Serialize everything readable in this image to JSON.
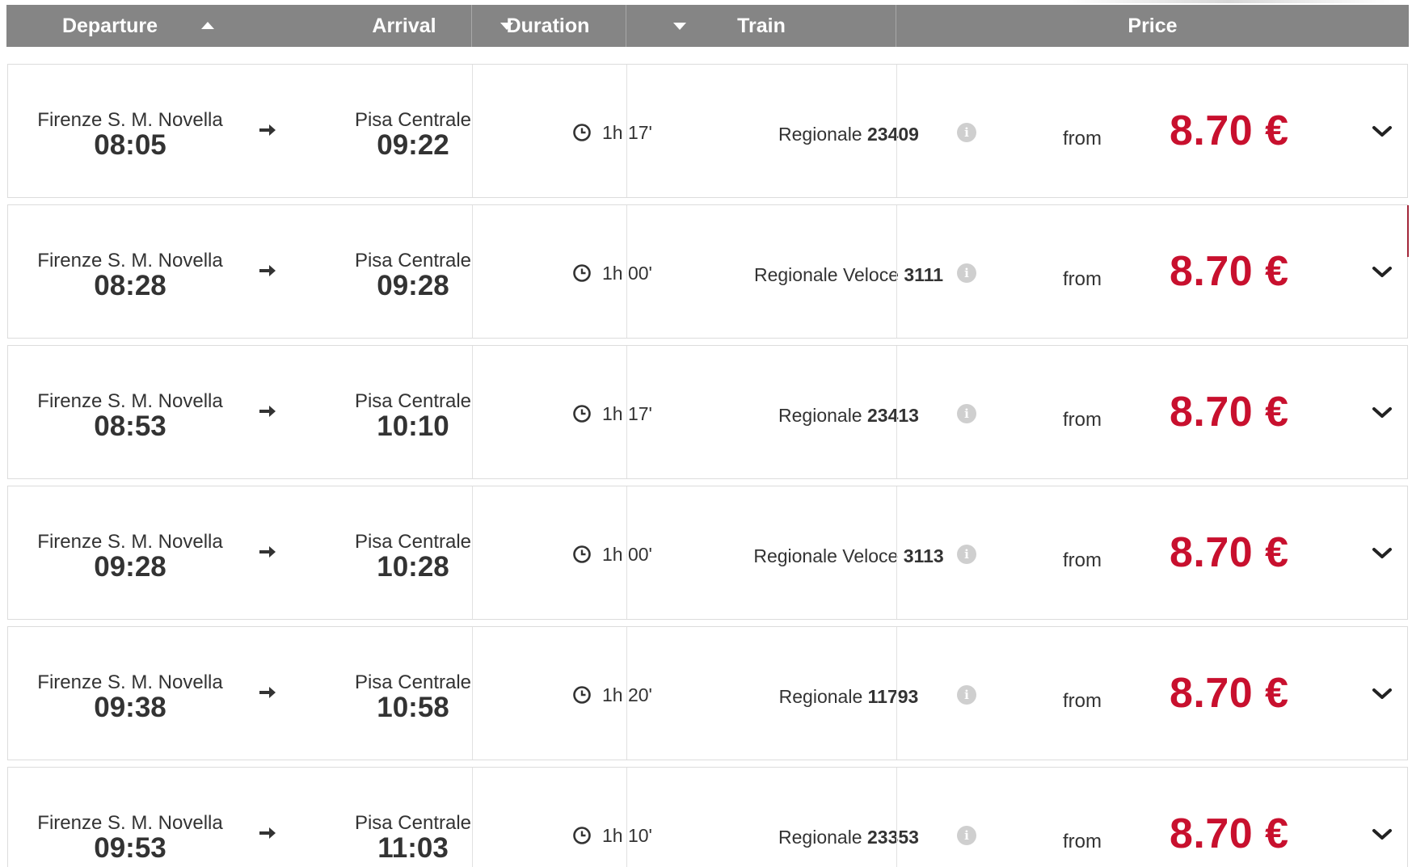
{
  "header": {
    "departure_label": "Departure",
    "arrival_label": "Arrival",
    "duration_label": "Duration",
    "train_label": "Train",
    "price_label": "Price"
  },
  "solutions": [
    {
      "dep_station": "Firenze S. M. Novella",
      "dep_time": "08:05",
      "arr_station": "Pisa Centrale",
      "arr_time": "09:22",
      "duration": "1h 17'",
      "train_type": "Regionale",
      "train_number": "23409",
      "from_label": "from",
      "price": "8.70 €"
    },
    {
      "dep_station": "Firenze S. M. Novella",
      "dep_time": "08:28",
      "arr_station": "Pisa Centrale",
      "arr_time": "09:28",
      "duration": "1h 00'",
      "train_type": "Regionale Veloce",
      "train_number": "3111",
      "from_label": "from",
      "price": "8.70 €"
    },
    {
      "dep_station": "Firenze S. M. Novella",
      "dep_time": "08:53",
      "arr_station": "Pisa Centrale",
      "arr_time": "10:10",
      "duration": "1h 17'",
      "train_type": "Regionale",
      "train_number": "23413",
      "from_label": "from",
      "price": "8.70 €"
    },
    {
      "dep_station": "Firenze S. M. Novella",
      "dep_time": "09:28",
      "arr_station": "Pisa Centrale",
      "arr_time": "10:28",
      "duration": "1h 00'",
      "train_type": "Regionale Veloce",
      "train_number": "3113",
      "from_label": "from",
      "price": "8.70 €"
    },
    {
      "dep_station": "Firenze S. M. Novella",
      "dep_time": "09:38",
      "arr_station": "Pisa Centrale",
      "arr_time": "10:58",
      "duration": "1h 20'",
      "train_type": "Regionale",
      "train_number": "11793",
      "from_label": "from",
      "price": "8.70 €"
    },
    {
      "dep_station": "Firenze S. M. Novella",
      "dep_time": "09:53",
      "arr_station": "Pisa Centrale",
      "arr_time": "11:03",
      "duration": "1h 10'",
      "train_type": "Regionale",
      "train_number": "23353",
      "from_label": "from",
      "price": "8.70 €"
    }
  ],
  "colors": {
    "header_bg": "#858585",
    "price": "#c8102e",
    "info_icon": "#cfcfcf"
  },
  "icons": {
    "sort_departure": "sort-ascending-icon",
    "sort_other": "sort-descending-icon",
    "direction": "right-arrow-icon",
    "duration": "clock-icon",
    "train_info": "info-icon",
    "expand": "chevron-down-icon"
  }
}
